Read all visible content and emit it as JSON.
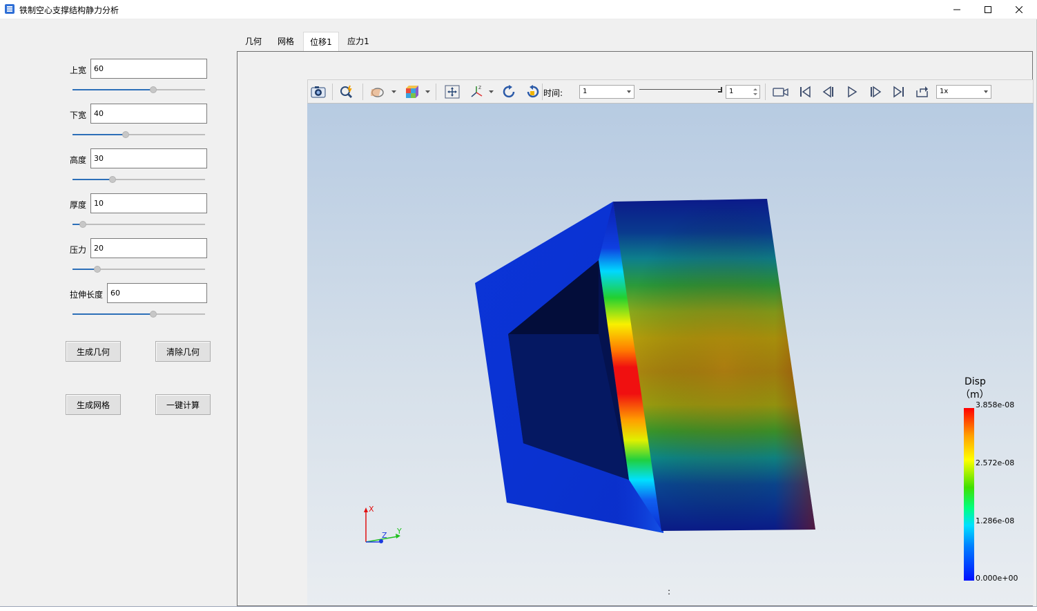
{
  "window": {
    "title": "铁制空心支撑结构静力分析"
  },
  "params": [
    {
      "label": "上宽",
      "value": "60",
      "slider_level": 0.61
    },
    {
      "label": "下宽",
      "value": "40",
      "slider_level": 0.4
    },
    {
      "label": "高度",
      "value": "30",
      "slider_level": 0.3
    },
    {
      "label": "厚度",
      "value": "10",
      "slider_level": 0.08
    },
    {
      "label": "压力",
      "value": "20",
      "slider_level": 0.19
    },
    {
      "label": "拉伸长度",
      "value": "60",
      "slider_level": 0.61
    }
  ],
  "buttons": {
    "generate_geometry": "生成几何",
    "clear_geometry": "清除几何",
    "generate_mesh": "生成网格",
    "one_click_compute": "一键计算"
  },
  "tabs": [
    {
      "label": "几何",
      "active": false
    },
    {
      "label": "网格",
      "active": false
    },
    {
      "label": "位移1",
      "active": true
    },
    {
      "label": "应力1",
      "active": false
    }
  ],
  "toolbar": {
    "time_label": "时间:",
    "time_value": "1",
    "step_value": "1",
    "speed_value": "1x",
    "icons": [
      "camera-icon",
      "zoom-icon",
      "clip-plane-icon",
      "color-cube-icon",
      "fit-view-icon",
      "axes-icon",
      "rotate-cw-icon",
      "rotate-ccw-icon",
      "record-icon",
      "first-frame-icon",
      "prev-frame-icon",
      "play-icon",
      "next-frame-icon",
      "last-frame-icon",
      "loop-icon"
    ]
  },
  "viewport": {
    "colon_mark": ":",
    "axes": {
      "x": "X",
      "y": "Y",
      "z": "Z"
    }
  },
  "legend": {
    "title_line1": "Disp",
    "title_line2": "（m）",
    "ticks": [
      "3.858e-08",
      "2.572e-08",
      "1.286e-08",
      "0.000e+00"
    ]
  },
  "colors": {
    "accent": "#2c6fb8",
    "model_blue": "#0a2a9e",
    "model_red": "#e00000"
  }
}
